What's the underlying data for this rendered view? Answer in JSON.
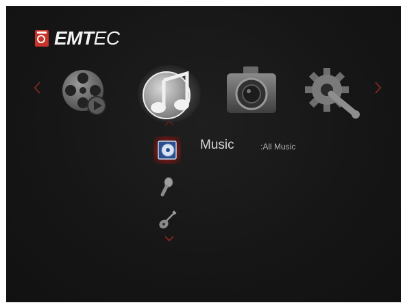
{
  "brand": {
    "name_bold": "EMT",
    "name_rest": "EC",
    "badge_color": "#c7352a"
  },
  "categories": [
    {
      "id": "video",
      "icon": "film-reel-icon",
      "selected": false
    },
    {
      "id": "music",
      "icon": "music-note-icon",
      "selected": true
    },
    {
      "id": "photo",
      "icon": "camera-icon",
      "selected": false
    },
    {
      "id": "setup",
      "icon": "gear-wrench-icon",
      "selected": false
    }
  ],
  "submenu": {
    "title": "Music",
    "subtitle": ":All Music",
    "items": [
      {
        "icon": "cd-disc-icon",
        "selected": true
      },
      {
        "icon": "microphone-icon",
        "selected": false
      },
      {
        "icon": "guitar-icon",
        "selected": false
      }
    ]
  },
  "colors": {
    "accent": "#c7352a",
    "background": "#161616",
    "text": "#d9d9d9"
  }
}
